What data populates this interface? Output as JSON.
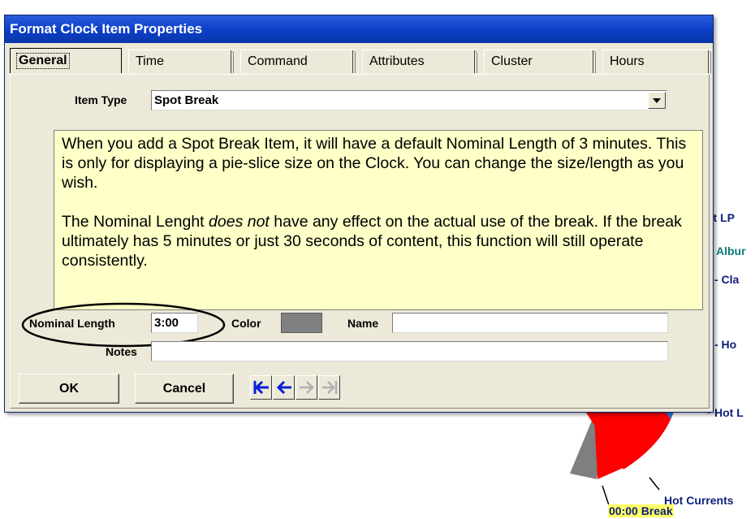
{
  "dialog": {
    "title": "Format Clock Item Properties",
    "tabs": [
      {
        "label": "General",
        "active": true
      },
      {
        "label": "Time"
      },
      {
        "label": "Command"
      },
      {
        "label": "Attributes"
      },
      {
        "label": "Cluster"
      },
      {
        "label": "Hours"
      }
    ],
    "item_type_label": "Item Type",
    "item_type_value": "Spot Break",
    "note_para1": "When you add a Spot Break Item, it will have a default Nominal Length of 3 minutes.  This is only for displaying a pie-slice size on the Clock. You can change the size/length as you wish.",
    "note_para2_before": "The Nominal Lenght ",
    "note_para2_em": "does not",
    "note_para2_after": " have any effect on the actual use of the break. If the break ultimately has 5 minutes or just 30 seconds of content, this function will still operate consistently.",
    "nominal_length_label": "Nominal Length",
    "nominal_length_value": "3:00",
    "color_label": "Color",
    "color_value": "#808080",
    "name_label": "Name",
    "name_value": "",
    "notes_label": "Notes",
    "notes_value": "",
    "ok_label": "OK",
    "cancel_label": "Cancel",
    "nav_icons": [
      "first-record-icon",
      "previous-record-icon",
      "next-record-icon",
      "last-record-icon"
    ]
  },
  "clock": {
    "labels": [
      "pt LP",
      "Albur",
      "- Cla",
      "- Ho",
      "Hot L",
      "Hot Currents",
      "00:00 Break"
    ],
    "colors": {
      "red": "#ff0000",
      "gray": "#7f7f7f",
      "blue": "#1e7cf0",
      "label": "#0c1f7a"
    }
  },
  "colors": {
    "title_bar": "#0b3fc8",
    "dialog_bg": "#ece9d8",
    "note_bg": "#ffffc8",
    "nav_arrow_active": "#0a1ed8",
    "nav_arrow_disabled": "#b0b0b0"
  }
}
